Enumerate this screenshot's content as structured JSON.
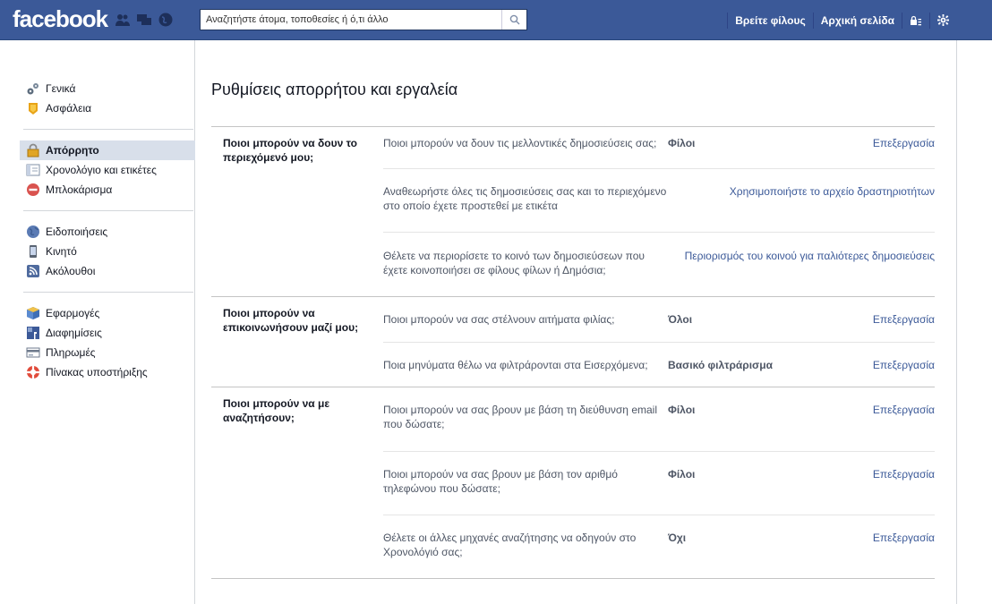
{
  "header": {
    "logo": "facebook",
    "search_placeholder": "Αναζητήστε άτομα, τοποθεσίες ή ό,τι άλλο",
    "find_friends": "Βρείτε φίλους",
    "home": "Αρχική σελίδα",
    "colors": {
      "bar": "#3b5998",
      "link": "#3b5998"
    }
  },
  "sidebar": {
    "groups": [
      [
        {
          "label": "Γενικά",
          "icon": "gears-icon"
        },
        {
          "label": "Ασφάλεια",
          "icon": "badge-icon"
        }
      ],
      [
        {
          "label": "Απόρρητο",
          "icon": "lock-icon",
          "active": true
        },
        {
          "label": "Χρονολόγιο και ετικέτες",
          "icon": "timeline-icon"
        },
        {
          "label": "Μπλοκάρισμα",
          "icon": "block-icon"
        }
      ],
      [
        {
          "label": "Ειδοποιήσεις",
          "icon": "globe-icon"
        },
        {
          "label": "Κινητό",
          "icon": "mobile-icon"
        },
        {
          "label": "Ακόλουθοι",
          "icon": "rss-icon"
        }
      ],
      [
        {
          "label": "Εφαρμογές",
          "icon": "apps-icon"
        },
        {
          "label": "Διαφημίσεις",
          "icon": "ads-icon"
        },
        {
          "label": "Πληρωμές",
          "icon": "payments-icon"
        },
        {
          "label": "Πίνακας υποστήριξης",
          "icon": "support-icon"
        }
      ]
    ]
  },
  "main": {
    "title": "Ρυθμίσεις απορρήτου και εργαλεία",
    "sections": [
      {
        "heading": "Ποιοι μπορούν να δουν το περιεχόμενό μου;",
        "rows": [
          {
            "question": "Ποιοι μπορούν να δουν τις μελλοντικές δημοσιεύσεις σας;",
            "value": "Φίλοι",
            "action": "Επεξεργασία"
          },
          {
            "question": "Αναθεωρήστε όλες τις δημοσιεύσεις σας και το περιεχόμενο στο οποίο έχετε προστεθεί με ετικέτα",
            "value": "",
            "action": "Χρησιμοποιήστε το αρχείο δραστηριοτήτων"
          },
          {
            "question": "Θέλετε να περιορίσετε το κοινό των δημοσιεύσεων που έχετε κοινοποιήσει σε φίλους φίλων ή Δημόσια;",
            "value": "",
            "action": "Περιορισμός του κοινού για παλιότερες δημοσιεύσεις"
          }
        ]
      },
      {
        "heading": "Ποιοι μπορούν να επικοινωνήσουν μαζί μου;",
        "rows": [
          {
            "question": "Ποιοι μπορούν να σας στέλνουν αιτήματα φιλίας;",
            "value": "Όλοι",
            "action": "Επεξεργασία"
          },
          {
            "question": "Ποια μηνύματα θέλω να φιλτράρονται στα Εισερχόμενα;",
            "value": "Βασικό φιλτράρισμα",
            "action": "Επεξεργασία"
          }
        ]
      },
      {
        "heading": "Ποιοι μπορούν να με αναζητήσουν;",
        "rows": [
          {
            "question": "Ποιοι μπορούν να σας βρουν με βάση τη διεύθυνση email που δώσατε;",
            "value": "Φίλοι",
            "action": "Επεξεργασία"
          },
          {
            "question": "Ποιοι μπορούν να σας βρουν με βάση τον αριθμό τηλεφώνου που δώσατε;",
            "value": "Φίλοι",
            "action": "Επεξεργασία"
          },
          {
            "question": "Θέλετε οι άλλες μηχανές αναζήτησης να οδηγούν στο Χρονολόγιό σας;",
            "value": "Όχι",
            "action": "Επεξεργασία"
          }
        ]
      }
    ]
  }
}
